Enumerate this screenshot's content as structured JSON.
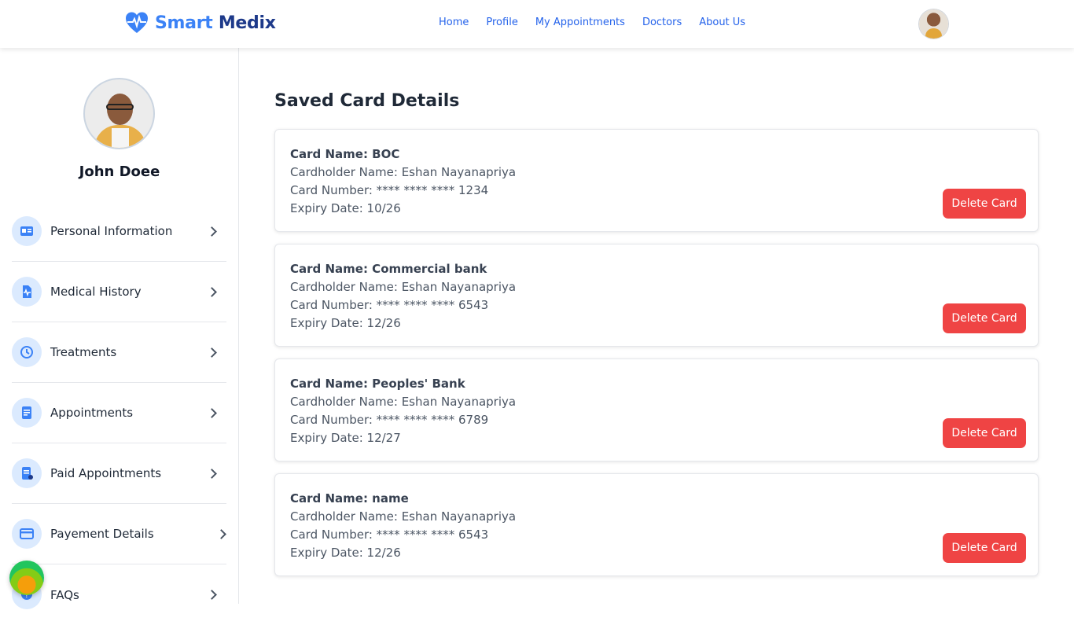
{
  "header": {
    "logo_part1": "Smart",
    "logo_part2": "Medix",
    "nav": [
      "Home",
      "Profile",
      "My Appointments",
      "Doctors",
      "About Us"
    ]
  },
  "sidebar": {
    "user_name": "John Doee",
    "items": [
      {
        "label": "Personal Information",
        "icon": "id-card-icon"
      },
      {
        "label": "Medical History",
        "icon": "medical-file-icon"
      },
      {
        "label": "Treatments",
        "icon": "history-clock-icon"
      },
      {
        "label": "Appointments",
        "icon": "document-icon"
      },
      {
        "label": "Paid Appointments",
        "icon": "paid-document-icon"
      },
      {
        "label": "Payement Details",
        "icon": "credit-card-icon"
      },
      {
        "label": "FAQs",
        "icon": "faq-icon"
      }
    ]
  },
  "main": {
    "title": "Saved Card Details",
    "delete_label": "Delete Card",
    "cards": [
      {
        "name": "Card Name: BOC",
        "holder": "Cardholder Name: Eshan Nayanapriya",
        "number": "Card Number: **** **** **** 1234",
        "expiry": "Expiry Date: 10/26"
      },
      {
        "name": "Card Name: Commercial bank",
        "holder": "Cardholder Name: Eshan Nayanapriya",
        "number": "Card Number: **** **** **** 6543",
        "expiry": "Expiry Date: 12/26"
      },
      {
        "name": "Card Name: Peoples' Bank",
        "holder": "Cardholder Name: Eshan Nayanapriya",
        "number": "Card Number: **** **** **** 6789",
        "expiry": "Expiry Date: 12/27"
      },
      {
        "name": "Card Name: name",
        "holder": "Cardholder Name: Eshan Nayanapriya",
        "number": "Card Number: **** **** **** 6543",
        "expiry": "Expiry Date: 12/26"
      }
    ]
  },
  "colors": {
    "brand_blue": "#3b82f6",
    "brand_dark": "#1e3a8a",
    "nav_link": "#2563eb",
    "delete": "#ef4444",
    "icon_bg": "#dbeafe"
  }
}
